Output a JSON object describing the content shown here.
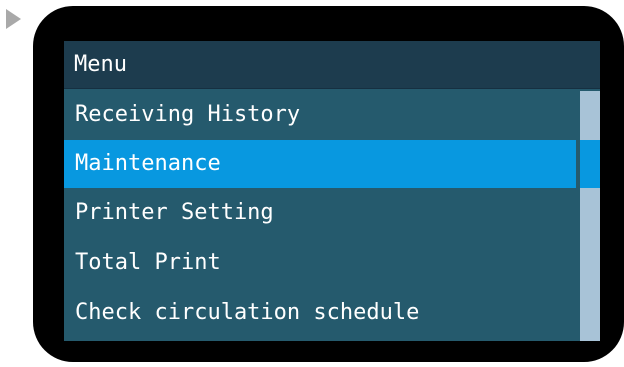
{
  "colors": {
    "device_frame": "#000000",
    "title_bar": "#1d3c4e",
    "list_background": "#255a6d",
    "selected_item": "#0898e0",
    "scrollbar_track": "#a8c3d7",
    "scrollbar_thumb": "#0898e0",
    "pointer": "#a9a9a9"
  },
  "icons": {
    "pointer": "right-triangle-pointer-icon"
  },
  "menu": {
    "title": "Menu",
    "selected_index": 1,
    "items": [
      {
        "label": "Receiving History"
      },
      {
        "label": "Maintenance"
      },
      {
        "label": "Printer Setting"
      },
      {
        "label": "Total Print"
      },
      {
        "label": "Check circulation schedule"
      }
    ]
  }
}
